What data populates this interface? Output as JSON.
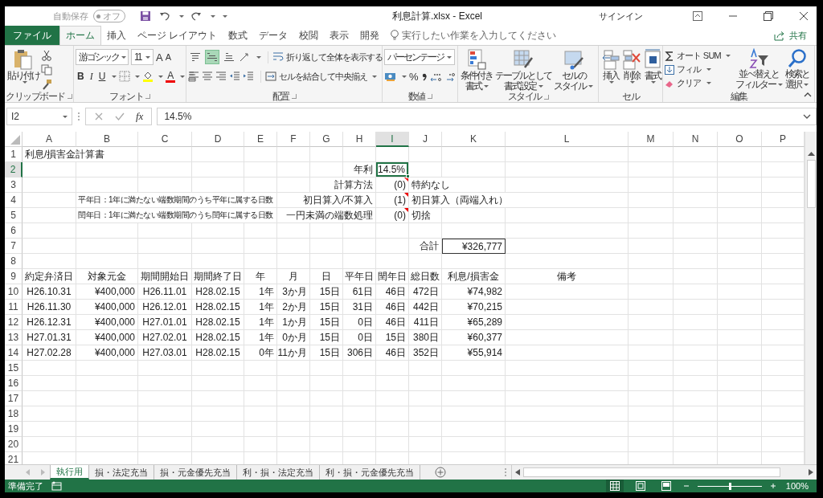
{
  "window": {
    "autosave_label": "自動保存",
    "autosave_state": "オフ",
    "autosave_on": false,
    "title": "利息計算.xlsx  -  Excel",
    "sign_in": "サインイン"
  },
  "ribbon_tabs": [
    {
      "label": "ファイル",
      "kind": "file",
      "selected": false
    },
    {
      "label": "ホーム",
      "kind": "tab",
      "selected": true
    },
    {
      "label": "挿入",
      "kind": "tab",
      "selected": false
    },
    {
      "label": "ページ レイアウト",
      "kind": "tab",
      "selected": false
    },
    {
      "label": "数式",
      "kind": "tab",
      "selected": false
    },
    {
      "label": "データ",
      "kind": "tab",
      "selected": false
    },
    {
      "label": "校閲",
      "kind": "tab",
      "selected": false
    },
    {
      "label": "表示",
      "kind": "tab",
      "selected": false
    },
    {
      "label": "開発",
      "kind": "tab",
      "selected": false
    }
  ],
  "tell_me": {
    "placeholder": "実行したい作業を入力してください"
  },
  "share": "共有",
  "ribbon": {
    "clipboard": {
      "paste": "貼り付け",
      "label": "クリップボード"
    },
    "font": {
      "name": "游ゴシック",
      "size": "11",
      "grow": "A",
      "shrink": "A",
      "bold": "B",
      "italic": "I",
      "underline": "U",
      "font_color_letter": "A",
      "label": "フォント"
    },
    "alignment": {
      "vertical": [
        {
          "kind": "top",
          "selected": false
        },
        {
          "kind": "middle",
          "selected": true
        },
        {
          "kind": "bottom",
          "selected": false
        }
      ],
      "wrap": "折り返して全体を表示する",
      "merge": "セルを結合して中央揃え",
      "label": "配置"
    },
    "number": {
      "format": "パーセンテージ",
      "percent": "%",
      "label": "数値"
    },
    "styles": {
      "buttons": [
        {
          "kind": "conditional",
          "lines": [
            "条件付き",
            "書式"
          ]
        },
        {
          "kind": "table",
          "lines": [
            "テーブルとして",
            "書式設定"
          ]
        },
        {
          "kind": "cell",
          "lines": [
            "セルの",
            "スタイル"
          ]
        }
      ],
      "label": "スタイル"
    },
    "cells": {
      "buttons": [
        {
          "kind": "insert",
          "label": "挿入"
        },
        {
          "kind": "delete",
          "label": "削除"
        },
        {
          "kind": "format",
          "label": "書式"
        }
      ],
      "label": "セル"
    },
    "editing": {
      "autosum": "オート SUM",
      "fill": "フィル",
      "clear": "クリア",
      "sort_lines": [
        "並べ替えと",
        "フィルター"
      ],
      "find_lines": [
        "検索と",
        "選択"
      ],
      "label": "編集"
    }
  },
  "formula_bar": {
    "name_box": "I2",
    "fx": "fx",
    "value": "14.5%"
  },
  "sheet": {
    "columns": [
      {
        "label": "A",
        "selected": false
      },
      {
        "label": "B",
        "selected": false
      },
      {
        "label": "C",
        "selected": false
      },
      {
        "label": "D",
        "selected": false
      },
      {
        "label": "E",
        "selected": false
      },
      {
        "label": "F",
        "selected": false
      },
      {
        "label": "G",
        "selected": false
      },
      {
        "label": "H",
        "selected": false
      },
      {
        "label": "I",
        "selected": true
      },
      {
        "label": "J",
        "selected": false
      },
      {
        "label": "K",
        "selected": false
      },
      {
        "label": "L",
        "selected": false
      },
      {
        "label": "M",
        "selected": false
      },
      {
        "label": "N",
        "selected": false
      },
      {
        "label": "O",
        "selected": false
      },
      {
        "label": "P",
        "selected": false
      }
    ],
    "rows": [
      {
        "number": "1",
        "selected": false,
        "cells": {
          "A": {
            "kind": "left",
            "text": "利息/損害金計算書",
            "comment": false
          }
        }
      },
      {
        "number": "2",
        "selected": true,
        "cells": {
          "H": {
            "kind": "right",
            "text": "年利",
            "comment": false
          },
          "I": {
            "kind": "right",
            "text": "14.5%",
            "comment": false
          }
        }
      },
      {
        "number": "3",
        "selected": false,
        "cells": {
          "H": {
            "kind": "right",
            "text": "計算方法",
            "comment": false
          },
          "I": {
            "kind": "right",
            "text": "(0)",
            "comment": true
          },
          "J": {
            "kind": "left",
            "text": "特約なし",
            "comment": false
          }
        }
      },
      {
        "number": "4",
        "selected": false,
        "cells": {
          "B": {
            "kind": "note",
            "text": "平年日：1年に満たない端数期間のうち平年に属する日数",
            "comment": false
          },
          "H": {
            "kind": "right",
            "text": "初日算入/不算入",
            "comment": false
          },
          "I": {
            "kind": "right",
            "text": "(1)",
            "comment": true
          },
          "J": {
            "kind": "left",
            "text": "初日算入（両端入れ）",
            "comment": false
          }
        }
      },
      {
        "number": "5",
        "selected": false,
        "cells": {
          "B": {
            "kind": "note",
            "text": "閏年日：1年に満たない端数期間のうち閏年に属する日数",
            "comment": false
          },
          "H": {
            "kind": "right",
            "text": "一円未満の端数処理",
            "comment": false
          },
          "I": {
            "kind": "right",
            "text": "(0)",
            "comment": true
          },
          "J": {
            "kind": "left",
            "text": "切捨",
            "comment": false
          }
        }
      },
      {
        "number": "6",
        "selected": false
      },
      {
        "number": "7",
        "selected": false,
        "cells": {
          "J": {
            "kind": "right",
            "text": "合計",
            "comment": false
          },
          "K": {
            "kind": "total",
            "text": "¥326,777",
            "comment": false
          }
        }
      },
      {
        "number": "8",
        "selected": false
      },
      {
        "number": "9",
        "selected": false,
        "cells": {
          "A": {
            "kind": "center",
            "text": "約定弁済日",
            "comment": false
          },
          "B": {
            "kind": "center",
            "text": "対象元金",
            "comment": false
          },
          "C": {
            "kind": "center",
            "text": "期間開始日",
            "comment": false
          },
          "D": {
            "kind": "center",
            "text": "期間終了日",
            "comment": false
          },
          "E": {
            "kind": "center",
            "text": "年",
            "comment": false
          },
          "F": {
            "kind": "center",
            "text": "月",
            "comment": false
          },
          "G": {
            "kind": "center",
            "text": "日",
            "comment": false
          },
          "H": {
            "kind": "center",
            "text": "平年日",
            "comment": false
          },
          "I": {
            "kind": "center",
            "text": "閏年日",
            "comment": false
          },
          "J": {
            "kind": "center",
            "text": "総日数",
            "comment": false
          },
          "K": {
            "kind": "center",
            "text": "利息/損害金",
            "comment": false
          },
          "L": {
            "kind": "center",
            "text": "備考",
            "comment": false
          }
        }
      },
      {
        "number": "10",
        "selected": false,
        "cells": {
          "A": {
            "kind": "center",
            "text": "H26.10.31",
            "comment": false
          },
          "B": {
            "kind": "right",
            "text": "¥400,000",
            "comment": false
          },
          "C": {
            "kind": "center",
            "text": "H26.11.01",
            "comment": false
          },
          "D": {
            "kind": "center",
            "text": "H28.02.15",
            "comment": false
          },
          "E": {
            "kind": "right",
            "text": "1年",
            "comment": false
          },
          "F": {
            "kind": "right",
            "text": "3か月",
            "comment": false
          },
          "G": {
            "kind": "right",
            "text": "15日",
            "comment": false
          },
          "H": {
            "kind": "right",
            "text": "61日",
            "comment": false
          },
          "I": {
            "kind": "right",
            "text": "46日",
            "comment": false
          },
          "J": {
            "kind": "right",
            "text": "472日",
            "comment": false
          },
          "K": {
            "kind": "right",
            "text": "¥74,982",
            "comment": false
          }
        }
      },
      {
        "number": "11",
        "selected": false,
        "cells": {
          "A": {
            "kind": "center",
            "text": "H26.11.30",
            "comment": false
          },
          "B": {
            "kind": "right",
            "text": "¥400,000",
            "comment": false
          },
          "C": {
            "kind": "center",
            "text": "H26.12.01",
            "comment": false
          },
          "D": {
            "kind": "center",
            "text": "H28.02.15",
            "comment": false
          },
          "E": {
            "kind": "right",
            "text": "1年",
            "comment": false
          },
          "F": {
            "kind": "right",
            "text": "2か月",
            "comment": false
          },
          "G": {
            "kind": "right",
            "text": "15日",
            "comment": false
          },
          "H": {
            "kind": "right",
            "text": "31日",
            "comment": false
          },
          "I": {
            "kind": "right",
            "text": "46日",
            "comment": false
          },
          "J": {
            "kind": "right",
            "text": "442日",
            "comment": false
          },
          "K": {
            "kind": "right",
            "text": "¥70,215",
            "comment": false
          }
        }
      },
      {
        "number": "12",
        "selected": false,
        "cells": {
          "A": {
            "kind": "center",
            "text": "H26.12.31",
            "comment": false
          },
          "B": {
            "kind": "right",
            "text": "¥400,000",
            "comment": false
          },
          "C": {
            "kind": "center",
            "text": "H27.01.01",
            "comment": false
          },
          "D": {
            "kind": "center",
            "text": "H28.02.15",
            "comment": false
          },
          "E": {
            "kind": "right",
            "text": "1年",
            "comment": false
          },
          "F": {
            "kind": "right",
            "text": "1か月",
            "comment": false
          },
          "G": {
            "kind": "right",
            "text": "15日",
            "comment": false
          },
          "H": {
            "kind": "right",
            "text": "0日",
            "comment": false
          },
          "I": {
            "kind": "right",
            "text": "46日",
            "comment": false
          },
          "J": {
            "kind": "right",
            "text": "411日",
            "comment": false
          },
          "K": {
            "kind": "right",
            "text": "¥65,289",
            "comment": false
          }
        }
      },
      {
        "number": "13",
        "selected": false,
        "cells": {
          "A": {
            "kind": "center",
            "text": "H27.01.31",
            "comment": false
          },
          "B": {
            "kind": "right",
            "text": "¥400,000",
            "comment": false
          },
          "C": {
            "kind": "center",
            "text": "H27.02.01",
            "comment": false
          },
          "D": {
            "kind": "center",
            "text": "H28.02.15",
            "comment": false
          },
          "E": {
            "kind": "right",
            "text": "1年",
            "comment": false
          },
          "F": {
            "kind": "right",
            "text": "0か月",
            "comment": false
          },
          "G": {
            "kind": "right",
            "text": "15日",
            "comment": false
          },
          "H": {
            "kind": "right",
            "text": "0日",
            "comment": false
          },
          "I": {
            "kind": "right",
            "text": "15日",
            "comment": false
          },
          "J": {
            "kind": "right",
            "text": "380日",
            "comment": false
          },
          "K": {
            "kind": "right",
            "text": "¥60,377",
            "comment": false
          }
        }
      },
      {
        "number": "14",
        "selected": false,
        "cells": {
          "A": {
            "kind": "center",
            "text": "H27.02.28",
            "comment": false
          },
          "B": {
            "kind": "right",
            "text": "¥400,000",
            "comment": false
          },
          "C": {
            "kind": "center",
            "text": "H27.03.01",
            "comment": false
          },
          "D": {
            "kind": "center",
            "text": "H28.02.15",
            "comment": false
          },
          "E": {
            "kind": "right",
            "text": "0年",
            "comment": false
          },
          "F": {
            "kind": "right",
            "text": "11か月",
            "comment": false
          },
          "G": {
            "kind": "right",
            "text": "15日",
            "comment": false
          },
          "H": {
            "kind": "right",
            "text": "306日",
            "comment": false
          },
          "I": {
            "kind": "right",
            "text": "46日",
            "comment": false
          },
          "J": {
            "kind": "right",
            "text": "352日",
            "comment": false
          },
          "K": {
            "kind": "right",
            "text": "¥55,914",
            "comment": false
          }
        }
      },
      {
        "number": "15",
        "selected": false
      },
      {
        "number": "16",
        "selected": false
      },
      {
        "number": "17",
        "selected": false
      },
      {
        "number": "18",
        "selected": false
      },
      {
        "number": "19",
        "selected": false
      },
      {
        "number": "20",
        "selected": false
      },
      {
        "number": "21",
        "selected": false
      }
    ]
  },
  "sheet_tabs": [
    {
      "label": "執行用",
      "selected": true
    },
    {
      "label": "損・法定充当",
      "selected": false
    },
    {
      "label": "損・元金優先充当",
      "selected": false
    },
    {
      "label": "利・損・法定充当",
      "selected": false
    },
    {
      "label": "利・損・元金優先充当",
      "selected": false
    }
  ],
  "status_bar": {
    "status": "準備完了",
    "views": [
      {
        "kind": "normal",
        "selected": true
      },
      {
        "kind": "layout",
        "selected": false
      },
      {
        "kind": "break",
        "selected": false
      }
    ],
    "zoom": {
      "level": 0.5,
      "reading": "100%"
    }
  }
}
